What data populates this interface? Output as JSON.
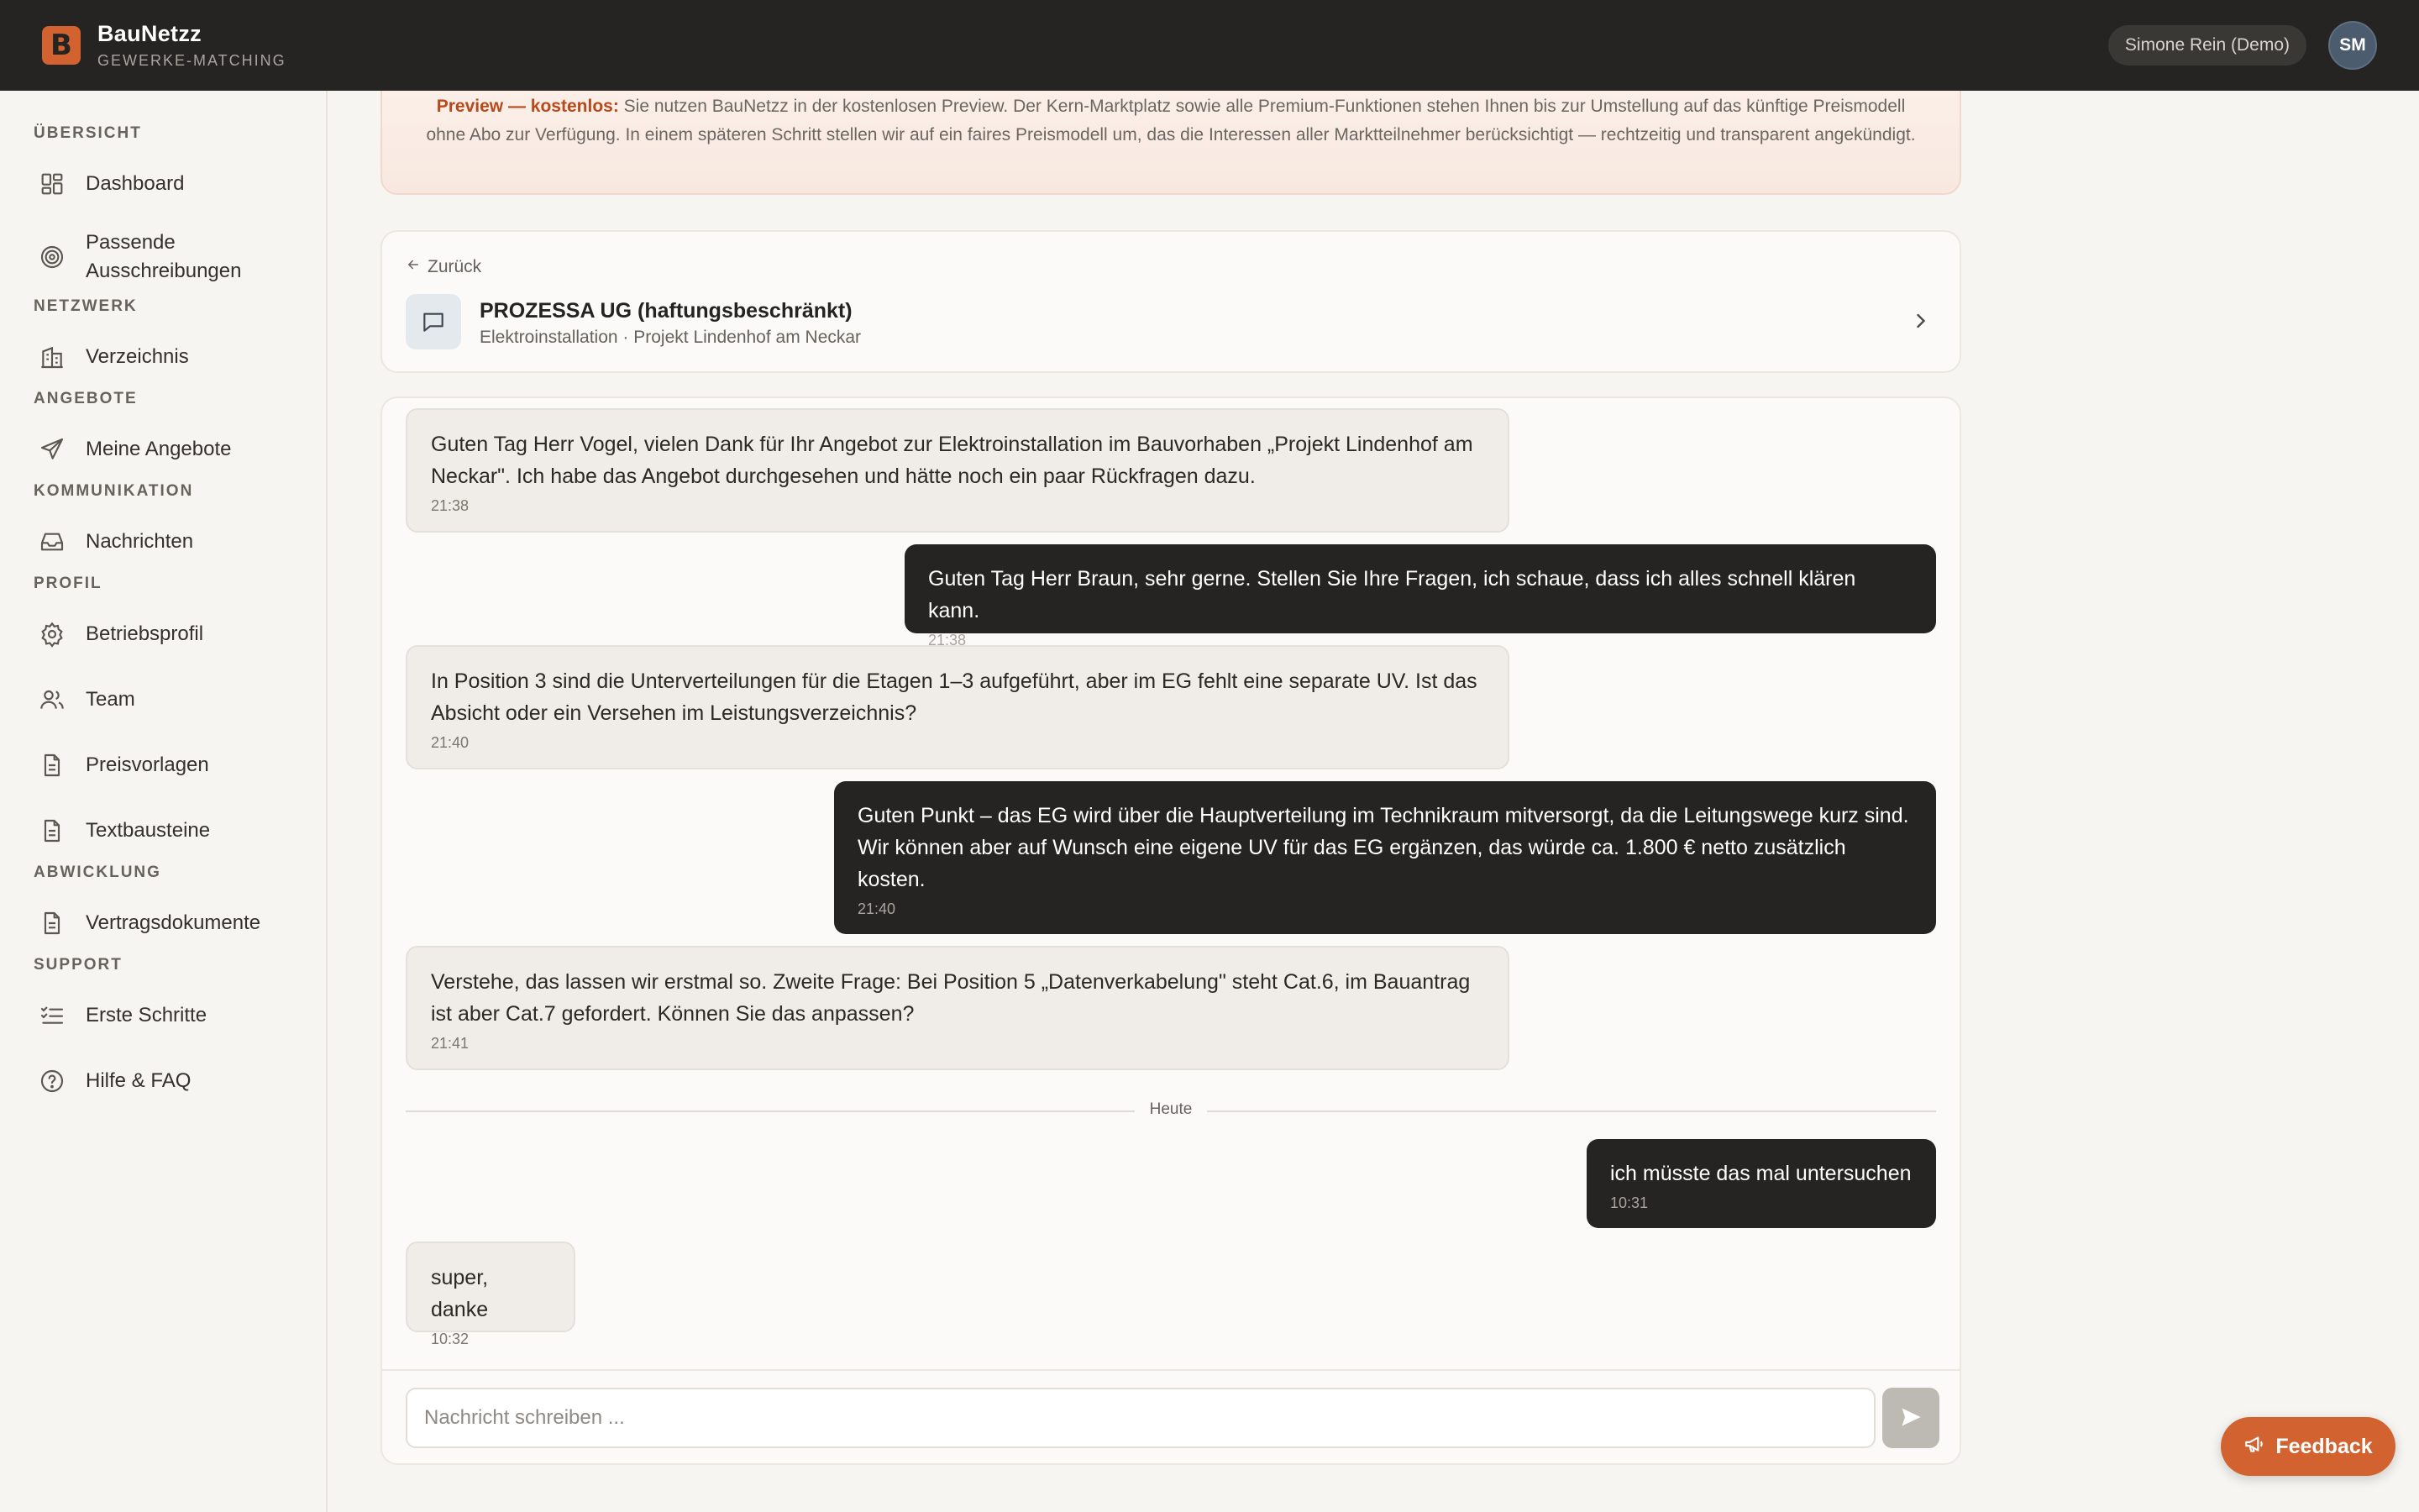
{
  "app": {
    "brand_name": "BauNetzz",
    "brand_sub": "GEWERKE-MATCHING",
    "logo_letter": "B",
    "accent_color": "#d2622f"
  },
  "topbar": {
    "user_label": "Simone Rein (Demo)",
    "avatar_initials": "SM"
  },
  "sidebar": {
    "sections": [
      {
        "title": "ÜBERSICHT",
        "items": [
          {
            "label": "Dashboard",
            "icon": "dashboard-icon"
          },
          {
            "label": "Passende Ausschreibungen",
            "icon": "target-icon"
          }
        ]
      },
      {
        "title": "NETZWERK",
        "items": [
          {
            "label": "Verzeichnis",
            "icon": "building-icon"
          }
        ]
      },
      {
        "title": "ANGEBOTE",
        "items": [
          {
            "label": "Meine Angebote",
            "icon": "send-icon"
          }
        ]
      },
      {
        "title": "KOMMUNIKATION",
        "items": [
          {
            "label": "Nachrichten",
            "icon": "inbox-icon"
          }
        ]
      },
      {
        "title": "PROFIL",
        "items": [
          {
            "label": "Betriebsprofil",
            "icon": "gear-icon"
          },
          {
            "label": "Team",
            "icon": "users-icon"
          },
          {
            "label": "Preisvorlagen",
            "icon": "document-icon"
          },
          {
            "label": "Textbausteine",
            "icon": "document-icon"
          }
        ]
      },
      {
        "title": "ABWICKLUNG",
        "items": [
          {
            "label": "Vertragsdokumente",
            "icon": "document-icon"
          }
        ]
      },
      {
        "title": "SUPPORT",
        "items": [
          {
            "label": "Erste Schritte",
            "icon": "checklist-icon"
          },
          {
            "label": "Hilfe & FAQ",
            "icon": "help-icon"
          }
        ]
      }
    ]
  },
  "banner": {
    "strong": "Preview — kostenlos:",
    "text": " Sie nutzen BauNetzz in der kostenlosen Preview. Der Kern-Marktplatz sowie alle Premium-Funktionen stehen Ihnen bis zur Umstellung auf das künftige Preismodell ohne Abo zur Verfügung. In einem späteren Schritt stellen wir auf ein faires Preismodell um, das die Interessen aller Marktteilnehmer berücksichtigt — rechtzeitig und transparent angekündigt."
  },
  "conversation": {
    "back_label": "Zurück",
    "title": "PROZESSA UG (haftungsbeschränkt)",
    "subtitle": "Elektroinstallation · Projekt Lindenhof am Neckar"
  },
  "messages": [
    {
      "dir": "in",
      "text": "Guten Tag Herr Vogel, vielen Dank für Ihr Angebot zur Elektroinstallation im Bauvorhaben „Projekt Lindenhof am Neckar\". Ich habe das Angebot durchgesehen und hätte noch ein paar Rückfragen dazu.",
      "time": "21:38"
    },
    {
      "dir": "out",
      "text": "Guten Tag Herr Braun, sehr gerne. Stellen Sie Ihre Fragen, ich schaue, dass ich alles schnell klären kann.",
      "time": "21:38"
    },
    {
      "dir": "in",
      "text": "In Position 3 sind die Unterverteilungen für die Etagen 1–3 aufgeführt, aber im EG fehlt eine separate UV. Ist das Absicht oder ein Versehen im Leistungsverzeichnis?",
      "time": "21:40"
    },
    {
      "dir": "out",
      "text": "Guten Punkt – das EG wird über die Hauptverteilung im Technikraum mitversorgt, da die Leitungswege kurz sind. Wir können aber auf Wunsch eine eigene UV für das EG ergänzen, das würde ca. 1.800 € netto zusätzlich kosten.",
      "time": "21:40"
    },
    {
      "dir": "in",
      "text": "Verstehe, das lassen wir erstmal so. Zweite Frage: Bei Position 5 „Datenverkabelung\" steht Cat.6, im Bauantrag ist aber Cat.7 gefordert. Können Sie das anpassen?",
      "time": "21:41"
    },
    {
      "dir": "out",
      "text": "ich müsste das mal untersuchen",
      "time": "10:31"
    },
    {
      "dir": "in",
      "text": "super, danke",
      "time": "10:32"
    }
  ],
  "divider_label": "Heute",
  "composer": {
    "placeholder": "Nachricht schreiben ...",
    "send_icon": "send-arrow-icon"
  },
  "feedback": {
    "label": "Feedback",
    "icon": "megaphone-icon"
  }
}
